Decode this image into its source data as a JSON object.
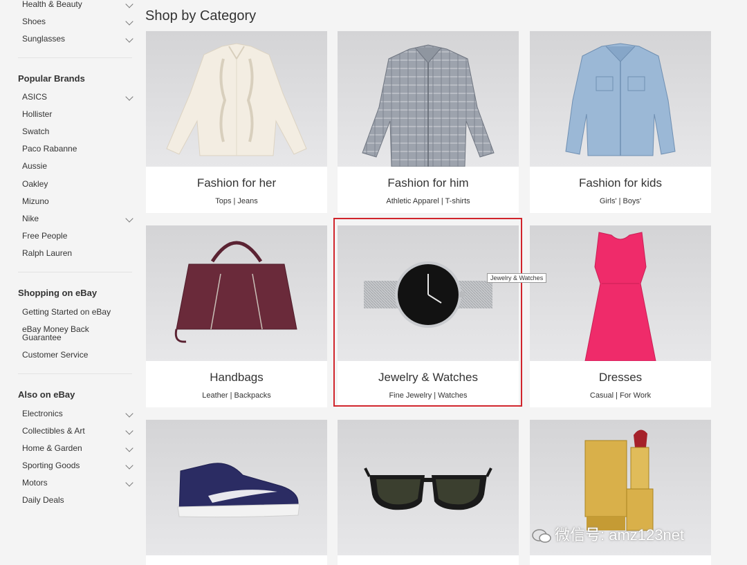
{
  "sidebar": {
    "top_items": [
      {
        "label": "Health & Beauty",
        "expandable": true
      },
      {
        "label": "Shoes",
        "expandable": true
      },
      {
        "label": "Sunglasses",
        "expandable": true
      }
    ],
    "popular_brands": {
      "heading": "Popular Brands",
      "items": [
        "ASICS",
        "Hollister",
        "Swatch",
        "Paco Rabanne",
        "Aussie",
        "Oakley",
        "Mizuno",
        "Nike",
        "Free People",
        "Ralph Lauren"
      ]
    },
    "shopping_on_ebay": {
      "heading": "Shopping on eBay",
      "items": [
        "Getting Started on eBay",
        "eBay Money Back Guarantee",
        "Customer Service"
      ]
    },
    "also_on_ebay": {
      "heading": "Also on eBay",
      "items": [
        "Electronics",
        "Collectibles & Art",
        "Home & Garden",
        "Sporting Goods",
        "Motors",
        "Daily Deals"
      ]
    }
  },
  "main": {
    "title": "Shop by Category",
    "categories": [
      {
        "title": "Fashion for her",
        "sub": "Tops | Jeans",
        "image": "blouse"
      },
      {
        "title": "Fashion for him",
        "sub": "Athletic Apparel | T-shirts",
        "image": "plaid-shirt"
      },
      {
        "title": "Fashion for kids",
        "sub": "Girls' | Boys'",
        "image": "denim-jacket"
      },
      {
        "title": "Handbags",
        "sub": "Leather | Backpacks",
        "image": "handbag"
      },
      {
        "title": "Jewelry & Watches",
        "sub": "Fine Jewelry | Watches",
        "image": "watch"
      },
      {
        "title": "Dresses",
        "sub": "Casual | For Work",
        "image": "pink-dress"
      },
      {
        "title": "",
        "sub": "",
        "image": "sneaker"
      },
      {
        "title": "",
        "sub": "",
        "image": "sunglasses"
      },
      {
        "title": "",
        "sub": "",
        "image": "lipstick"
      }
    ],
    "tooltip": "Jewelry & Watches",
    "highlight_color": "#d0242b"
  },
  "watermark": "微信号: amz123net"
}
